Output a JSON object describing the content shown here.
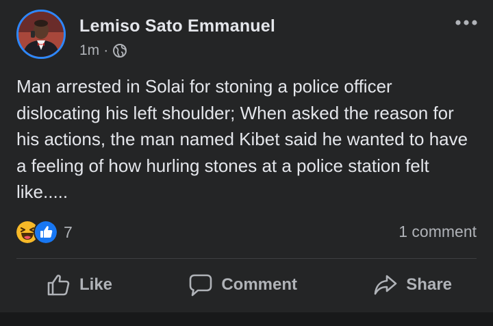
{
  "post": {
    "author": "Lemiso Sato Emmanuel",
    "timestamp": "1m",
    "separator": "·",
    "audience_icon": "globe-icon",
    "more_icon": "more-options-icon",
    "text": "Man arrested in Solai for stoning a police officer dislocating his left shoulder; When asked the reason for his actions, the man named Kibet said he wanted to have a feeling of how hurling stones at a police station felt like....."
  },
  "engagement": {
    "reaction_icons": [
      "haha-reaction-icon",
      "like-reaction-icon"
    ],
    "reaction_count": "7",
    "comment_count": "1 comment"
  },
  "actions": {
    "like_label": "Like",
    "comment_label": "Comment",
    "share_label": "Share"
  },
  "colors": {
    "background": "#242526",
    "text": "#e4e6eb",
    "secondary_text": "#b0b3b8",
    "accent": "#2d88ff",
    "haha": "#f7b928"
  }
}
